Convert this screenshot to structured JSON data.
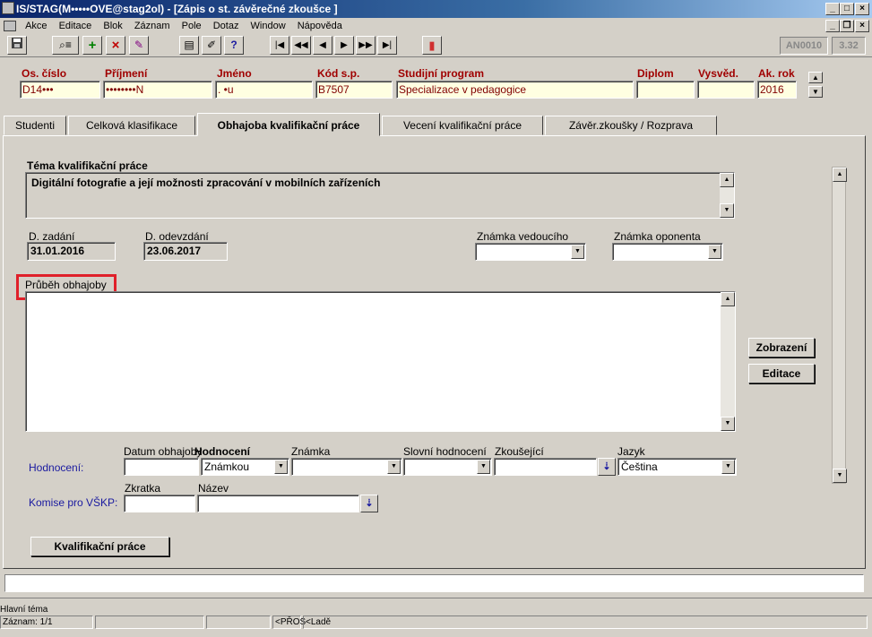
{
  "window": {
    "title": "IS/STAG(M•••••OVE@stag2ol) - [Zápis o st. závěrečné zkoušce ]",
    "min": "_",
    "max": "□",
    "close": "×",
    "child_min": "_",
    "child_restore": "❐",
    "child_close": "×"
  },
  "menu": [
    "Akce",
    "Editace",
    "Blok",
    "Záznam",
    "Pole",
    "Dotaz",
    "Window",
    "Nápověda"
  ],
  "toolbar": {
    "form_code": "AN0010",
    "version": "3.32",
    "icons": [
      "save-icon",
      "query-icon",
      "insert-icon",
      "delete-icon",
      "clear-icon",
      "copy-icon",
      "edit-icon",
      "help-icon",
      "first-icon",
      "prev-block-icon",
      "prev-icon",
      "next-icon",
      "next-block-icon",
      "last-icon",
      "exit-icon"
    ]
  },
  "header": {
    "labels": {
      "os_cislo": "Os. číslo",
      "prijmeni": "Příjmení",
      "jmeno": "Jméno",
      "kod_sp": "Kód s.p.",
      "studijni_program": "Studijní program",
      "diplom": "Diplom",
      "vysved": "Vysvěd.",
      "ak_rok": "Ak. rok"
    },
    "values": {
      "os_cislo": "D14•••",
      "prijmeni": "••••••••N",
      "jmeno": ". •u",
      "kod_sp": "B7507",
      "studijni_program": "Specializace v pedagogice",
      "diplom": "",
      "vysved": "",
      "ak_rok": "2016"
    },
    "spin_up": "▲",
    "spin_down": "▼"
  },
  "tabs": [
    {
      "label": "Studenti",
      "active": false
    },
    {
      "label": "Celková klasifikace",
      "active": false
    },
    {
      "label": "Obhajoba kvalifikační práce",
      "active": true
    },
    {
      "label": "Vecení kvalifikační práce",
      "active": false
    },
    {
      "label": "Závěr.zkoušky / Rozprava",
      "active": false
    }
  ],
  "form": {
    "tema_label": "Téma kvalifikační práce",
    "tema_value": "Digitální fotografie a její možnosti zpracování v mobilních zařízeních",
    "d_zadani_label": "D. zadání",
    "d_zadani_value": "31.01.2016",
    "d_odevzdani_label": "D. odevzdání",
    "d_odevzdani_value": "23.06.2017",
    "znamka_vedouciho_label": "Známka vedoucího",
    "znamka_oponenta_label": "Známka oponenta",
    "prubeh_label": "Průběh obhajoby",
    "prubeh_value": "",
    "zobrazeni_btn": "Zobrazení",
    "editace_btn": "Editace",
    "hodnoceni_row_label": "Hodnocení:",
    "datum_obhajoby_label": "Datum obhajoby",
    "hodnoceni_col_label": "Hodnocení",
    "znamka_label": "Známka",
    "slovni_label": "Slovní hodnocení",
    "zkousejici_label": "Zkoušející",
    "jazyk_label": "Jazyk",
    "hodnoceni_value": "Známkou",
    "jazyk_value": "Čeština",
    "komise_label": "Komise pro VŠKP:",
    "zkratka_label": "Zkratka",
    "nazev_label": "Název",
    "kvalifikacni_btn": "Kvalifikační práce",
    "dd_arrow": "▼",
    "dl_arrow": "⇣"
  },
  "status": {
    "hint": "Hlavní téma",
    "zaznam": "Záznam: 1/1",
    "cell_a": "<PŘOS",
    "cell_b": "<Ladě"
  }
}
